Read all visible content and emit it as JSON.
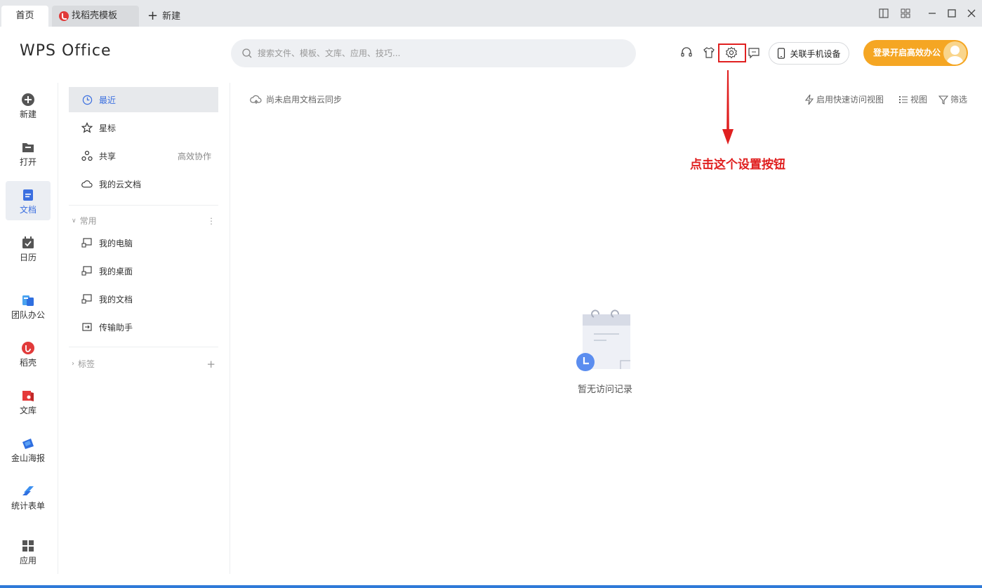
{
  "tabs": [
    {
      "label": "首页"
    },
    {
      "label": "找稻壳模板"
    },
    {
      "label": "新建"
    }
  ],
  "header": {
    "logo": "WPS Office",
    "search_placeholder": "搜索文件、模板、文库、应用、技巧...",
    "phone_button": "关联手机设备",
    "login_button": "登录开启高效办公"
  },
  "icons": {
    "headset": "headset-icon",
    "skin": "shirt-icon",
    "settings": "gear-icon",
    "feedback": "chat-icon"
  },
  "leftnav": [
    {
      "label": "新建",
      "icon": "plus-circle-icon"
    },
    {
      "label": "打开",
      "icon": "folder-icon"
    },
    {
      "label": "文档",
      "icon": "document-icon",
      "active": true
    },
    {
      "label": "日历",
      "icon": "calendar-icon"
    },
    {
      "label": "团队办公",
      "icon": "team-icon"
    },
    {
      "label": "稻壳",
      "icon": "daoke-icon"
    },
    {
      "label": "文库",
      "icon": "library-icon"
    },
    {
      "label": "金山海报",
      "icon": "poster-icon"
    },
    {
      "label": "统计表单",
      "icon": "form-icon"
    },
    {
      "label": "应用",
      "icon": "apps-icon"
    }
  ],
  "sidebar": {
    "items": [
      {
        "label": "最近",
        "active": true
      },
      {
        "label": "星标"
      },
      {
        "label": "共享",
        "extra": "高效协作"
      },
      {
        "label": "我的云文档"
      }
    ],
    "common_group": "常用",
    "common_items": [
      {
        "label": "我的电脑"
      },
      {
        "label": "我的桌面"
      },
      {
        "label": "我的文档"
      },
      {
        "label": "传输助手"
      }
    ],
    "tags_group": "标签"
  },
  "main": {
    "cloud_sync": "尚未启用文档云同步",
    "quick_view": "启用快速访问视图",
    "view": "视图",
    "filter": "筛选",
    "empty_text": "暂无访问记录"
  },
  "annotation": {
    "text": "点击这个设置按钮",
    "color": "#e02020"
  },
  "colors": {
    "accent": "#3b6fe0",
    "login": "#f5a623"
  }
}
